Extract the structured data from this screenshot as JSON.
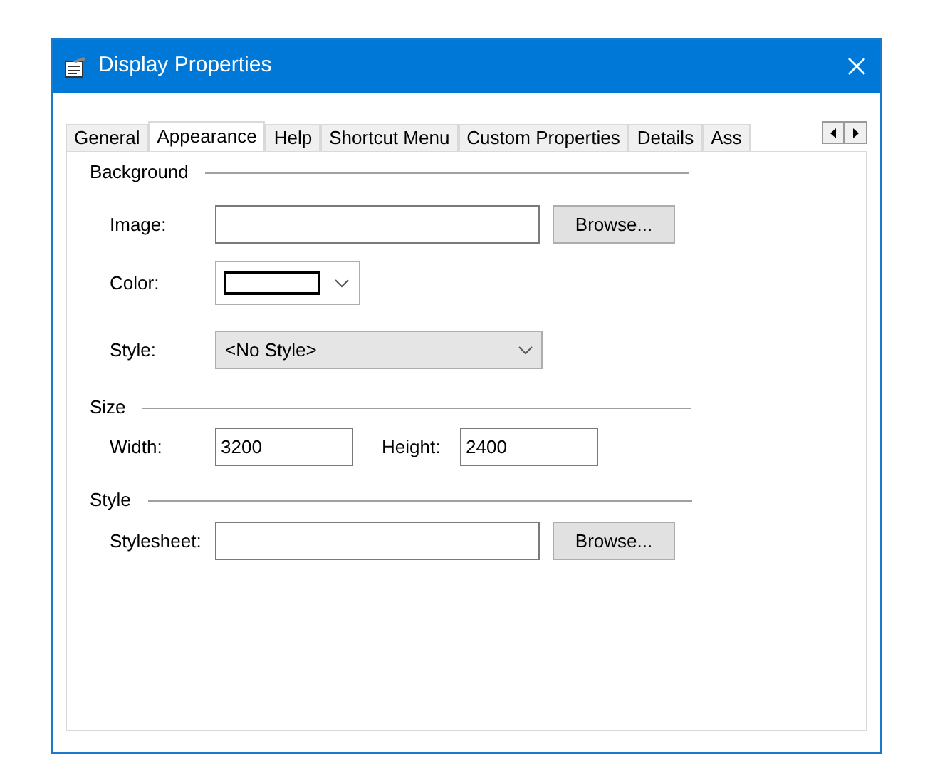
{
  "window": {
    "title": "Display Properties"
  },
  "tabs": [
    {
      "label": "General",
      "selected": false
    },
    {
      "label": "Appearance",
      "selected": true
    },
    {
      "label": "Help",
      "selected": false
    },
    {
      "label": "Shortcut Menu",
      "selected": false
    },
    {
      "label": "Custom Properties",
      "selected": false
    },
    {
      "label": "Details",
      "selected": false
    },
    {
      "label": "Ass",
      "selected": false
    }
  ],
  "background": {
    "heading": "Background",
    "image_label": "Image:",
    "image_browse": "Browse...",
    "color_label": "Color:",
    "color": "#ffffff",
    "style_label": "Style:",
    "style_value": "<No Style>"
  },
  "size": {
    "heading": "Size",
    "width_label": "Width:",
    "width_value": "3200",
    "height_label": "Height:",
    "height_value": "2400"
  },
  "style": {
    "heading": "Style",
    "stylesheet_label": "Stylesheet:",
    "stylesheet_browse": "Browse..."
  }
}
